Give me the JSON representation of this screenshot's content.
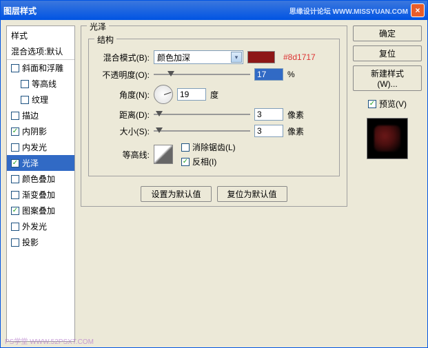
{
  "window": {
    "title": "图层样式",
    "watermark_top": "思缘设计论坛  WWW.MISSYUAN.COM",
    "close": "×"
  },
  "sidebar": {
    "header": "样式",
    "subheader": "混合选项:默认",
    "items": [
      {
        "label": "斜面和浮雕",
        "checked": false,
        "indent": false
      },
      {
        "label": "等高线",
        "checked": false,
        "indent": true
      },
      {
        "label": "纹理",
        "checked": false,
        "indent": true
      },
      {
        "label": "描边",
        "checked": false,
        "indent": false
      },
      {
        "label": "内阴影",
        "checked": true,
        "indent": false
      },
      {
        "label": "内发光",
        "checked": false,
        "indent": false
      },
      {
        "label": "光泽",
        "checked": true,
        "indent": false,
        "selected": true
      },
      {
        "label": "颜色叠加",
        "checked": false,
        "indent": false
      },
      {
        "label": "渐变叠加",
        "checked": false,
        "indent": false
      },
      {
        "label": "图案叠加",
        "checked": true,
        "indent": false
      },
      {
        "label": "外发光",
        "checked": false,
        "indent": false
      },
      {
        "label": "投影",
        "checked": false,
        "indent": false
      }
    ]
  },
  "panel": {
    "title": "光泽",
    "structure": "结构",
    "blend_label": "混合模式(B):",
    "blend_value": "颜色加深",
    "swatch_hex": "#8d1717",
    "opacity_label": "不透明度(O):",
    "opacity_value": "17",
    "opacity_unit": "%",
    "angle_label": "角度(N):",
    "angle_value": "19",
    "angle_unit": "度",
    "distance_label": "距离(D):",
    "distance_value": "3",
    "distance_unit": "像素",
    "size_label": "大小(S):",
    "size_value": "3",
    "size_unit": "像素",
    "contour_label": "等高线:",
    "antialias_label": "消除锯齿(L)",
    "invert_label": "反相(I)",
    "set_default": "设置为默认值",
    "reset_default": "复位为默认值"
  },
  "right": {
    "ok": "确定",
    "reset": "复位",
    "new_style": "新建样式(W)...",
    "preview": "预览(V)"
  },
  "footer_wm": "PS学堂  WWW.52PSXT.COM"
}
